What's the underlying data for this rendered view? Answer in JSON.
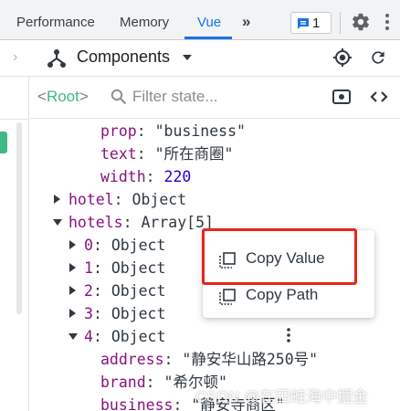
{
  "tabs": [
    {
      "label": "Performance",
      "active": false
    },
    {
      "label": "Memory",
      "active": false
    },
    {
      "label": "Vue",
      "active": true
    }
  ],
  "more_tabs_label": "»",
  "issues_count": "1",
  "components_bar": {
    "label": "Components"
  },
  "state_header": {
    "root_open": "<",
    "root_name": "Root",
    "root_close": ">",
    "filter_placeholder": "Filter state..."
  },
  "tree": [
    {
      "key": "prop",
      "value": "\"business\"",
      "vtype": "string"
    },
    {
      "key": "text",
      "value": "\"所在商圈\"",
      "vtype": "string"
    },
    {
      "key": "width",
      "value": "220",
      "vtype": "number"
    },
    {
      "key": "hotel",
      "value": "Object",
      "vtype": "plain",
      "toggle": "collapsed"
    },
    {
      "key": "hotels",
      "value": "Array[5]",
      "vtype": "plain",
      "toggle": "expanded"
    },
    {
      "key": "0",
      "value": "Object",
      "vtype": "plain",
      "toggle": "collapsed"
    },
    {
      "key": "1",
      "value": "Object",
      "vtype": "plain",
      "toggle": "collapsed"
    },
    {
      "key": "2",
      "value": "Object",
      "vtype": "plain",
      "toggle": "collapsed"
    },
    {
      "key": "3",
      "value": "Object",
      "vtype": "plain",
      "toggle": "collapsed"
    },
    {
      "key": "4",
      "value": "Object",
      "vtype": "plain",
      "toggle": "expanded"
    },
    {
      "key": "address",
      "value": "\"静安华山路250号\"",
      "vtype": "string"
    },
    {
      "key": "brand",
      "value": "\"希尔顿\"",
      "vtype": "string"
    },
    {
      "key": "business",
      "value": "\"静安寺商区\"",
      "vtype": "string"
    }
  ],
  "context_menu": {
    "items": [
      {
        "label": "Copy Value",
        "icon": "copy-icon"
      },
      {
        "label": "Copy Path",
        "icon": "copy-icon"
      }
    ]
  },
  "watermark": "CSDN @在田蛙海中掘金",
  "colors": {
    "vue_green": "#42b883",
    "active_tab": "#1a73e8",
    "key_purple": "#881280",
    "number_blue": "#1c00cf",
    "highlight_red": "#e8251c"
  }
}
